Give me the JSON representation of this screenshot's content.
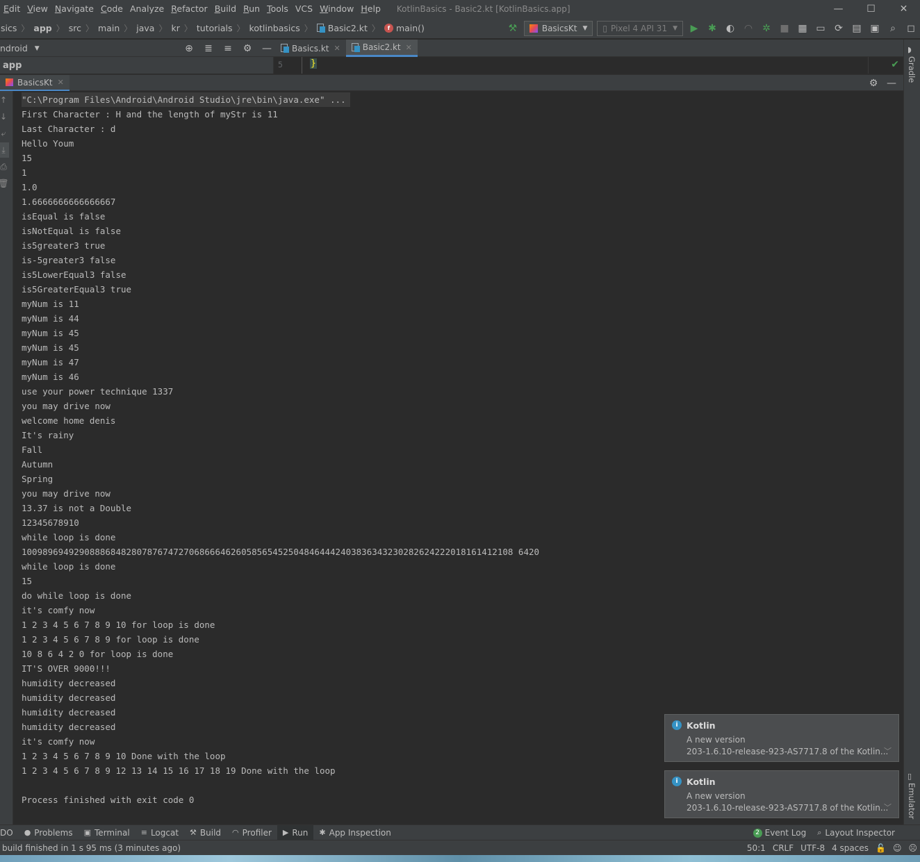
{
  "menu": {
    "items": [
      {
        "ul": "E",
        "rest": "dit"
      },
      {
        "ul": "V",
        "rest": "iew"
      },
      {
        "ul": "N",
        "rest": "avigate"
      },
      {
        "ul": "C",
        "rest": "ode"
      },
      {
        "ul": "",
        "rest": "Analyze"
      },
      {
        "ul": "R",
        "rest": "efactor"
      },
      {
        "ul": "B",
        "rest": "uild"
      },
      {
        "ul": "R",
        "rest": "un"
      },
      {
        "ul": "T",
        "rest": "ools"
      },
      {
        "ul": "",
        "rest": "VCS"
      },
      {
        "ul": "W",
        "rest": "indow"
      },
      {
        "ul": "H",
        "rest": "elp"
      }
    ],
    "window_title": "KotlinBasics - Basic2.kt [KotlinBasics.app]",
    "minimize": "—",
    "maximize": "☐",
    "close": "✕"
  },
  "breadcrumbs": {
    "items": [
      "sics",
      "app",
      "src",
      "main",
      "java",
      "kr",
      "tutorials",
      "kotlinbasics",
      "Basic2.kt",
      "main()"
    ],
    "separator": "〉"
  },
  "toolbar": {
    "run_config": "BasicsKt",
    "device": "Pixel 4 API 31"
  },
  "project_panel": {
    "view_selector": "ndroid",
    "root": "app"
  },
  "editor": {
    "tabs": [
      {
        "label": "Basics.kt",
        "active": false
      },
      {
        "label": "Basic2.kt",
        "active": true
      }
    ],
    "line_number": "5",
    "code_text": "}"
  },
  "side_tools": {
    "gradle": "Gradle",
    "emulator": "Emulator"
  },
  "run_panel": {
    "tab_label": "BasicsKt",
    "command_line": "\"C:\\Program Files\\Android\\Android Studio\\jre\\bin\\java.exe\" ...",
    "output": [
      "First Character : H and the length of myStr is 11",
      "Last Character : d",
      "Hello Youm",
      "15",
      "1",
      "1.0",
      "1.6666666666666667",
      "isEqual is false",
      "isNotEqual is false",
      "is5greater3 true",
      "is-5greater3 false",
      "is5LowerEqual3 false",
      "is5GreaterEqual3 true",
      "myNum is 11",
      "myNum is 44",
      "myNum is 45",
      "myNum is 45",
      "myNum is 47",
      "myNum is 46",
      "use your power technique 1337",
      "you may drive now",
      "welcome home denis",
      "It's rainy",
      "Fall",
      "Autumn",
      "Spring",
      "you may drive now",
      "13.37 is not a Double",
      "12345678910",
      "while loop is done",
      "1009896949290888684828078767472706866646260585654525048464442403836343230282624222018161412108 6420",
      "while loop is done",
      "15",
      "do while loop is done",
      "it's comfy now",
      "1 2 3 4 5 6 7 8 9 10 for loop is done",
      "1 2 3 4 5 6 7 8 9 for loop is done",
      "10 8 6 4 2 0 for loop is done",
      "IT'S OVER 9000!!!",
      "humidity decreased",
      "humidity decreased",
      "humidity decreased",
      "humidity decreased",
      "it's comfy now",
      "1 2 3 4 5 6 7 8 9 10 Done with the loop",
      "1 2 3 4 5 6 7 8 9 12 13 14 15 16 17 18 19 Done with the loop",
      "",
      "Process finished with exit code 0"
    ]
  },
  "notifications": [
    {
      "title": "Kotlin",
      "line1": "A new version",
      "line2": "203-1.6.10-release-923-AS7717.8 of the Kotlin..."
    },
    {
      "title": "Kotlin",
      "line1": "A new version",
      "line2": "203-1.6.10-release-923-AS7717.8 of the Kotlin..."
    }
  ],
  "bottom_tabs": {
    "left": [
      "DO",
      "Problems",
      "Terminal",
      "Logcat",
      "Build",
      "Profiler",
      "Run",
      "App Inspection"
    ],
    "event_log": "Event Log",
    "event_count": "2",
    "layout_inspector": "Layout Inspector"
  },
  "status": {
    "message": "build finished in 1 s 95 ms (3 minutes ago)",
    "position": "50:1",
    "line_sep": "CRLF",
    "encoding": "UTF-8",
    "indent": "4 spaces"
  },
  "colors": {
    "accent": "#4a88c7",
    "run_green": "#499c54",
    "background": "#2b2b2b",
    "panel": "#3c3f41"
  }
}
